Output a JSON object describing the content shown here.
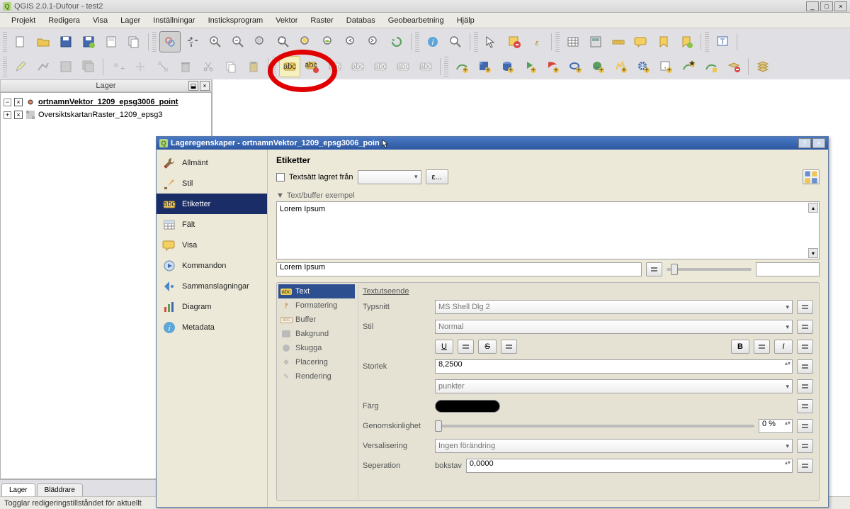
{
  "window": {
    "title": "QGIS 2.0.1-Dufour - test2"
  },
  "menu": [
    "Projekt",
    "Redigera",
    "Visa",
    "Lager",
    "Inställningar",
    "Insticksprogram",
    "Vektor",
    "Raster",
    "Databas",
    "Geobearbetning",
    "Hjälp"
  ],
  "layers_panel": {
    "title": "Lager",
    "tree": [
      {
        "name": "ortnamnVektor_1209_epsg3006_point",
        "checked": true,
        "type": "point"
      },
      {
        "name": "OversiktskartanRaster_1209_epsg3",
        "checked": true,
        "type": "raster"
      }
    ],
    "tabs": {
      "layers": "Lager",
      "browser": "Bläddrare"
    }
  },
  "status": "Togglar redigeringstillståndet för aktuellt",
  "dialog": {
    "title": "Lageregenskaper - ortnamnVektor_1209_epsg3006_poin",
    "sidebar": [
      {
        "id": "general",
        "label": "Allmänt"
      },
      {
        "id": "style",
        "label": "Stil"
      },
      {
        "id": "labels",
        "label": "Etiketter",
        "active": true
      },
      {
        "id": "fields",
        "label": "Fält"
      },
      {
        "id": "display",
        "label": "Visa"
      },
      {
        "id": "actions",
        "label": "Kommandon"
      },
      {
        "id": "joins",
        "label": "Sammanslagningar"
      },
      {
        "id": "diagrams",
        "label": "Diagram"
      },
      {
        "id": "metadata",
        "label": "Metadata"
      }
    ],
    "labels": {
      "heading": "Etiketter",
      "checkbox_label": "Textsätt lagret från",
      "expr_btn": "ε...",
      "preview_expander": "Text/buffer exempel",
      "preview_content": "Lorem Ipsum",
      "preview_input": "Lorem Ipsum",
      "aspects": [
        {
          "id": "text",
          "label": "Text",
          "active": true
        },
        {
          "id": "formatting",
          "label": "Formatering"
        },
        {
          "id": "buffer",
          "label": "Buffer"
        },
        {
          "id": "background",
          "label": "Bakgrund"
        },
        {
          "id": "shadow",
          "label": "Skugga"
        },
        {
          "id": "placement",
          "label": "Placering"
        },
        {
          "id": "rendering",
          "label": "Rendering"
        }
      ],
      "props": {
        "heading": "Textutseende",
        "font_label": "Typsnitt",
        "font_value": "MS Shell Dlg 2",
        "style_label": "Stil",
        "style_value": "Normal",
        "underline": "U",
        "strikeout": "S",
        "bold": "B",
        "italic": "I",
        "size_label": "Storlek",
        "size_value": "8,2500",
        "unit_value": "punkter",
        "color_label": "Färg",
        "transparency_label": "Genomskinlighet",
        "transparency_value": "0 %",
        "case_label": "Versalisering",
        "case_value": "Ingen förändring",
        "separation_label": "Seperation",
        "separation_tab": "bokstav",
        "separation_value": "0,0000"
      }
    }
  }
}
